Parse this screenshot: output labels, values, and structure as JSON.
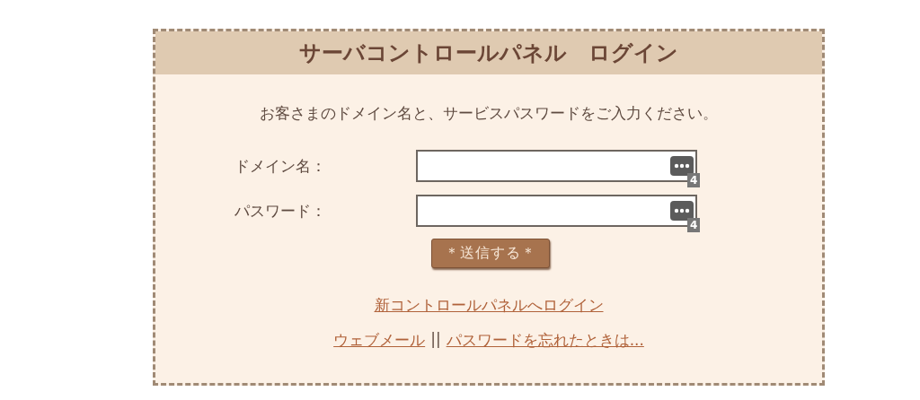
{
  "panel": {
    "title": "サーバコントロールパネル　ログイン",
    "instruction": "お客さまのドメイン名と、サービスパスワードをご入力ください。"
  },
  "fields": [
    {
      "label": "ドメイン名：",
      "badge": "4"
    },
    {
      "label": "パスワード：",
      "badge": "4"
    }
  ],
  "submit_button": "＊送信する＊",
  "new_panel_link": "新コントロールパネルへログイン",
  "footer_links": {
    "webmail": "ウェブメール",
    "separator": "||",
    "forgot_password": "パスワードを忘れたときは..."
  }
}
